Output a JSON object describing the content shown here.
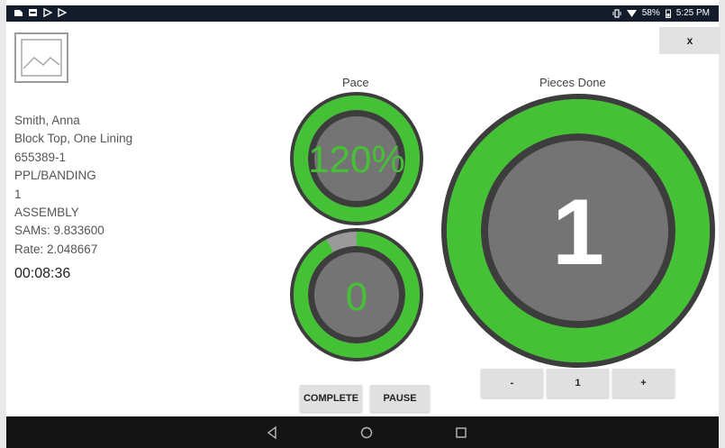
{
  "status_bar": {
    "battery_percent": "58%",
    "time": "5:25 PM",
    "left_icons": [
      "app-notification-icon",
      "image-notification-icon",
      "play-store-icon",
      "play-icon"
    ],
    "right_icons": [
      "vibrate-icon",
      "wifi-icon",
      "battery-icon"
    ]
  },
  "header": {
    "close_label": "x"
  },
  "info": {
    "name": "Smith, Anna",
    "style": "Block Top, One Lining",
    "order": "655389-1",
    "category": "PPL/BANDING",
    "quantity": "1",
    "operation": "ASSEMBLY",
    "sams": "SAMs: 9.833600",
    "rate": "Rate: 2.048667",
    "timer": "00:08:36"
  },
  "pace": {
    "label": "Pace",
    "value_text": "120%",
    "progress": 1.0
  },
  "current": {
    "value_text": "0",
    "progress": 0.92
  },
  "pieces": {
    "label": "Pieces Done",
    "value_text": "1",
    "progress": 1.0
  },
  "counter": {
    "minus_label": "-",
    "value": "1",
    "plus_label": "+"
  },
  "actions": {
    "complete_label": "COMPLETE",
    "pause_label": "PAUSE"
  },
  "colors": {
    "green": "#45c135",
    "dark_ring": "#3d3d3d",
    "inner_gray": "#747474",
    "track_gray": "#9a9a9a",
    "status_bar": "#141c2c"
  }
}
